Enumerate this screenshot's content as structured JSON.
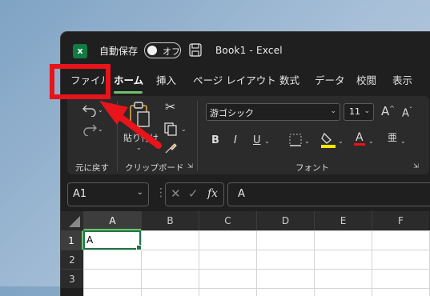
{
  "titlebar": {
    "app_icon_letter": "x",
    "autosave_label": "自動保存",
    "autosave_state": "オフ",
    "doc_title": "Book1  -  Excel"
  },
  "tabs": [
    "ファイル",
    "ホーム",
    "挿入",
    "ページ レイアウト",
    "数式",
    "データ",
    "校閲",
    "表示"
  ],
  "ribbon": {
    "undo_group_label": "元に戻す",
    "clipboard_group_label": "クリップボード",
    "paste_label": "貼り付け",
    "font_group_label": "フォント",
    "font_name": "游ゴシック",
    "font_size": "11",
    "bold": "B",
    "italic": "I",
    "underline": "U",
    "grow_font": "A",
    "shrink_font": "A",
    "font_color_letter": "A"
  },
  "formula_bar": {
    "name_box": "A1",
    "fx": "fx",
    "content": "A"
  },
  "grid": {
    "columns": [
      "A",
      "B",
      "C",
      "D",
      "E",
      "F"
    ],
    "rows": [
      "1",
      "2",
      "3"
    ],
    "cell_a1": "A"
  },
  "colors": {
    "accent_green": "#6ec26f",
    "annotation_red": "#e8141b",
    "excel_green": "#107c41"
  }
}
